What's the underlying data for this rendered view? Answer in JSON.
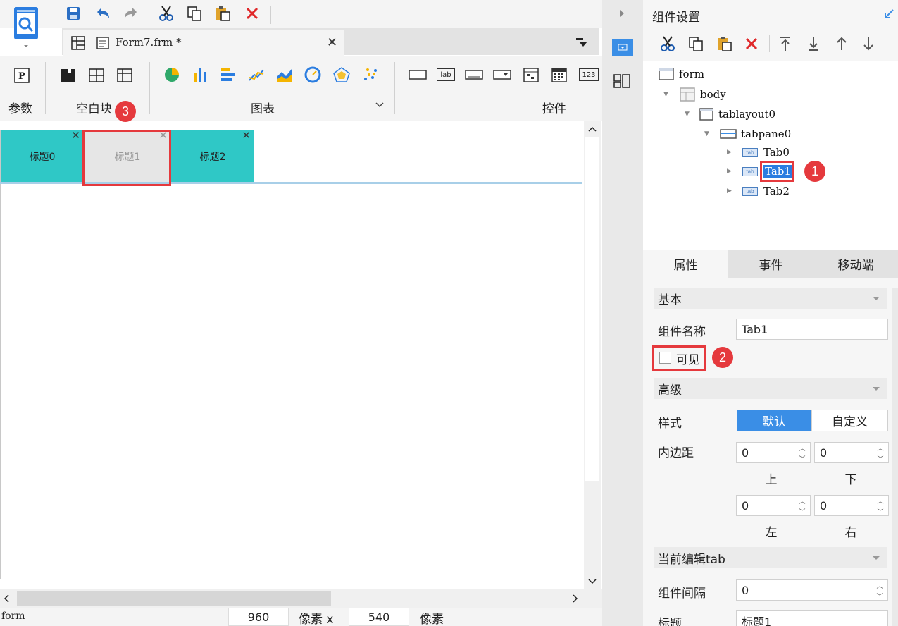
{
  "toolbar": {
    "ribbon_groups": {
      "params": "参数",
      "blank_blocks": "空白块",
      "charts": "图表",
      "controls": "控件"
    },
    "control_icons": {
      "label": "lab",
      "number": "123"
    }
  },
  "file_tab": {
    "title": "Form7.frm *"
  },
  "canvas": {
    "tabs": [
      {
        "label": "标题0"
      },
      {
        "label": "标题1"
      },
      {
        "label": "标题2"
      }
    ]
  },
  "statusbar": {
    "selected": "form",
    "width": "960",
    "unit1": "像素 x",
    "height": "540",
    "unit2": "像素"
  },
  "right_panel": {
    "title": "组件设置",
    "tree": {
      "form": "form",
      "body": "body",
      "tablayout": "tablayout0",
      "tabpane": "tabpane0",
      "tab_badge": "tab",
      "tabs": [
        "Tab0",
        "Tab1",
        "Tab2"
      ]
    },
    "prop_tabs": [
      "属性",
      "事件",
      "移动端"
    ],
    "basic": {
      "section": "基本",
      "name_label": "组件名称",
      "name_value": "Tab1",
      "visible_label": "可见"
    },
    "advanced": {
      "section": "高级",
      "style_label": "样式",
      "style_default": "默认",
      "style_custom": "自定义",
      "padding_label": "内边距",
      "top": "0",
      "bottom": "0",
      "left": "0",
      "right": "0",
      "top_label": "上",
      "bottom_label": "下",
      "left_label": "左",
      "right_label": "右"
    },
    "current_tab": {
      "section": "当前编辑tab",
      "gap_label": "组件间隔",
      "gap_value": "0",
      "title_label": "标题",
      "title_value": "标题1"
    }
  },
  "annotations": [
    "1",
    "2",
    "3"
  ],
  "colors": {
    "accent": "#3a8ee6",
    "tab_teal": "#2fc8c6",
    "tab_hidden": "#e6e6e6",
    "marker_red": "#e5393d"
  }
}
